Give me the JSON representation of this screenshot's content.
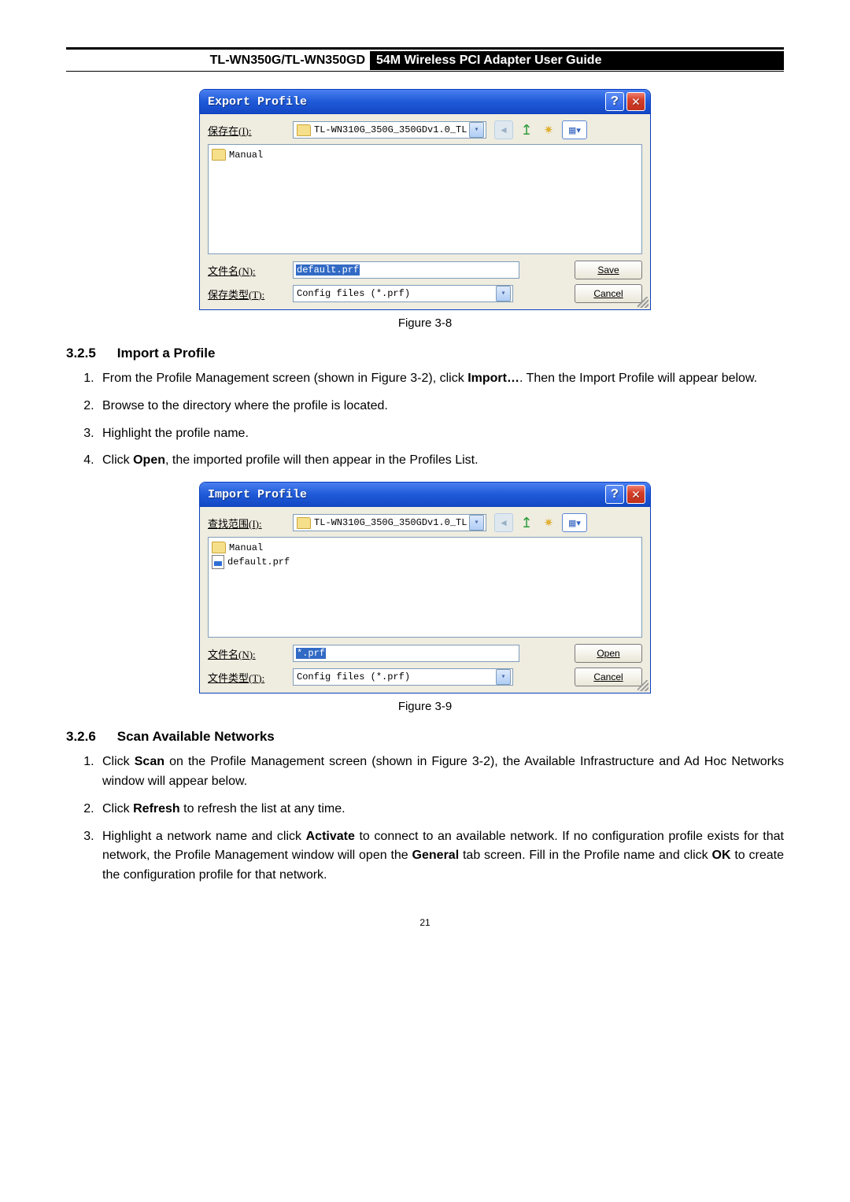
{
  "header": {
    "left": "TL-WN350G/TL-WN350GD",
    "right": "54M Wireless PCI Adapter User Guide"
  },
  "dialog1": {
    "title": "Export Profile",
    "help": "?",
    "close": "✕",
    "save_in_label": "保存在(I):",
    "folder": "TL-WN310G_350G_350GDv1.0_TL",
    "file_list": [
      "Manual"
    ],
    "filename_label": "文件名(N):",
    "filename_value": "default.prf",
    "filetype_label": "保存类型(T):",
    "filetype_value": "Config files (*.prf)",
    "save_btn": "Save",
    "cancel_btn": "Cancel"
  },
  "caption1": "Figure 3-8",
  "sec325": {
    "num": "3.2.5",
    "title": "Import a Profile",
    "items": [
      {
        "pre": "From the Profile Management screen (shown in Figure 3-2), click ",
        "b": "Import…",
        "post": ". Then the Import Profile will appear below."
      },
      {
        "pre": "Browse to the directory where the profile is located.",
        "b": "",
        "post": ""
      },
      {
        "pre": "Highlight the profile name.",
        "b": "",
        "post": ""
      },
      {
        "pre": "Click ",
        "b": "Open",
        "post": ", the imported profile will then appear in the Profiles List."
      }
    ]
  },
  "dialog2": {
    "title": "Import Profile",
    "help": "?",
    "close": "✕",
    "look_in_label": "查找范围(I):",
    "folder": "TL-WN310G_350G_350GDv1.0_TL",
    "file_list": [
      "Manual",
      "default.prf"
    ],
    "filename_label": "文件名(N):",
    "filename_value": "*.prf",
    "filetype_label": "文件类型(T):",
    "filetype_value": "Config files (*.prf)",
    "open_btn": "Open",
    "cancel_btn": "Cancel"
  },
  "caption2": "Figure 3-9",
  "sec326": {
    "num": "3.2.6",
    "title": "Scan Available Networks",
    "item1": {
      "pre": "Click ",
      "b1": "Scan",
      "post1": " on the Profile Management screen (shown in Figure 3-2), the Available Infrastructure and Ad Hoc Networks window will appear below."
    },
    "item2": {
      "pre": "Click ",
      "b": "Refresh",
      "post": " to refresh the list at any time."
    },
    "item3": {
      "p1": "Highlight a network name and click ",
      "b1": "Activate",
      "p2": " to connect to an available network. If no configuration profile exists for that network, the Profile Management window will open the ",
      "b2": "General",
      "p3": " tab screen. Fill in the Profile name and click ",
      "b3": "OK",
      "p4": " to create the configuration profile for that network."
    }
  },
  "page_num": "21"
}
